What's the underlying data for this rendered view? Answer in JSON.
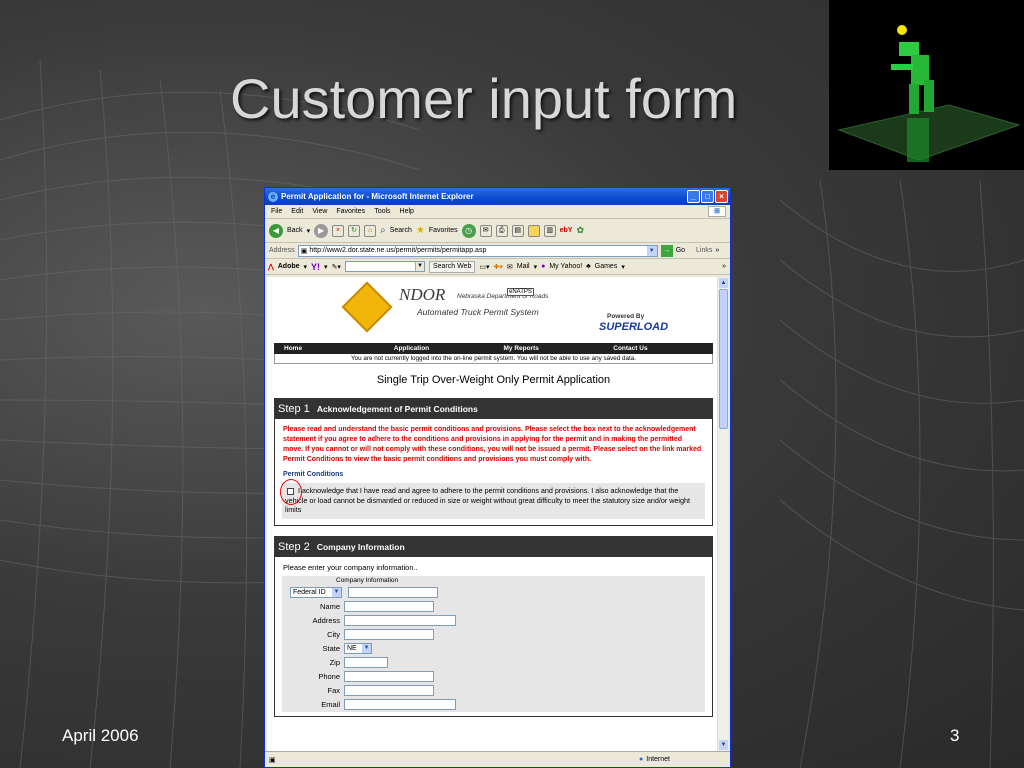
{
  "slide": {
    "title": "Customer input form",
    "date": "April 2006",
    "page": "3"
  },
  "browser": {
    "window_title": "Permit Application for - Microsoft Internet Explorer",
    "menu": [
      "File",
      "Edit",
      "View",
      "Favorites",
      "Tools",
      "Help"
    ],
    "toolbar": {
      "back": "Back",
      "search": "Search",
      "favorites": "Favorites"
    },
    "address_label": "Address",
    "url": "http://www2.dor.state.ne.us/permit/permits/permitapp.asp",
    "go": "Go",
    "links": "Links",
    "adobe": "Adobe",
    "search_web": "Search Web",
    "mail": "Mail",
    "my_yahoo": "My Yahoo!",
    "games": "Games",
    "status_zone": "Internet"
  },
  "page": {
    "logo_name": "NDOR",
    "logo_dept": "Nebraska Department of Roads",
    "logo_badge": "eNATPS",
    "logo_system": "Automated Truck Permit System",
    "powered_by": "Powered By",
    "superload": "SUPERLOAD",
    "nav": [
      "Home",
      "Application",
      "My Reports",
      "Contact Us"
    ],
    "not_logged": "You are not currently logged into the on-line permit system. You will not be able to use any saved data.",
    "app_title": "Single Trip Over-Weight Only Permit Application",
    "step1": {
      "num": "Step 1",
      "label": "Acknowledgement of Permit Conditions",
      "warning": "Please read and understand the basic permit conditions and provisions. Please select the box next to the acknowledgement statement if you agree to adhere to the conditions and provisions in applying for the permit and in making the permitted move. If you cannot or will not comply with these conditions, you will not be issued a permit. Please select on the link marked Permit Conditions to view the basic permit conditions and provisions you must comply with.",
      "link": "Permit Conditions",
      "ack": "I acknowledge that I have read and agree to adhere to the permit conditions and provisions.  I also acknowledge that the vehicle or load cannot be dismantled or reduced in size or weight without great difficulty to meet the statutory size and/or weight limits"
    },
    "step2": {
      "num": "Step 2",
      "label": "Company Information",
      "intro": "Please enter your company information..",
      "form_heading": "Company Information",
      "id_type": "Federal ID",
      "fields": [
        "Name",
        "Address",
        "City",
        "State",
        "Zip",
        "Phone",
        "Fax",
        "Email"
      ],
      "state_value": "NE"
    }
  }
}
